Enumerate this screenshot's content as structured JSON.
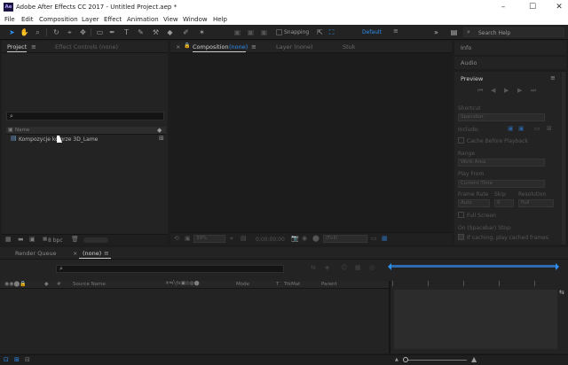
{
  "window": {
    "title": "Adobe After Effects CC 2017 - Untitled Project.aep *",
    "app_icon": "Ae"
  },
  "menu": [
    "File",
    "Edit",
    "Composition",
    "Layer",
    "Effect",
    "Animation",
    "View",
    "Window",
    "Help"
  ],
  "toolbar": {
    "snapping_label": "Snapping",
    "workspace": "Default",
    "search_placeholder": "Search Help"
  },
  "project_panel": {
    "tabs": {
      "project": "Project",
      "effect_controls": "Effect Controls (none)"
    },
    "name_header": "Name",
    "items": [
      {
        "name": "Kompozycje kolorze 3D_Lame"
      }
    ],
    "bpc": "8 bpc"
  },
  "viewer": {
    "tabs": {
      "composition": "Composition",
      "composition_state": "(none)",
      "layer": "Layer (none)",
      "flowchart": "Stuk"
    },
    "zoom": "39%",
    "timecode": "0;00;00;00",
    "resolution": "(Full)"
  },
  "right_panels": {
    "info": "Info",
    "audio": "Audio",
    "preview": "Preview",
    "shortcut_label": "Shortcut",
    "shortcut_value": "Spacebar",
    "include_label": "Include:",
    "cache_before": "Cache Before Playback",
    "range_label": "Range",
    "range_value": "Work Area",
    "play_from_label": "Play From",
    "play_from_value": "Current Time",
    "frame_rate_label": "Frame Rate",
    "skip_label": "Skip",
    "resolution_label": "Resolution",
    "frame_rate_value": "Auto",
    "skip_value": "0",
    "resolution_value": "Full",
    "full_screen": "Full Screen",
    "on_stop_label": "On (Spacebar) Stop:",
    "caching_option": "If caching, play cached frames"
  },
  "timeline": {
    "tabs": {
      "render_queue": "Render Queue",
      "comp": "(none)"
    },
    "columns": {
      "num": "#",
      "source_name": "Source Name",
      "mode": "Mode",
      "t": "T",
      "trkmat": "TrkMat",
      "parent": "Parent"
    }
  },
  "colors": {
    "accent": "#2e8ef0",
    "panel": "#232323",
    "background": "#1d1d1d"
  }
}
